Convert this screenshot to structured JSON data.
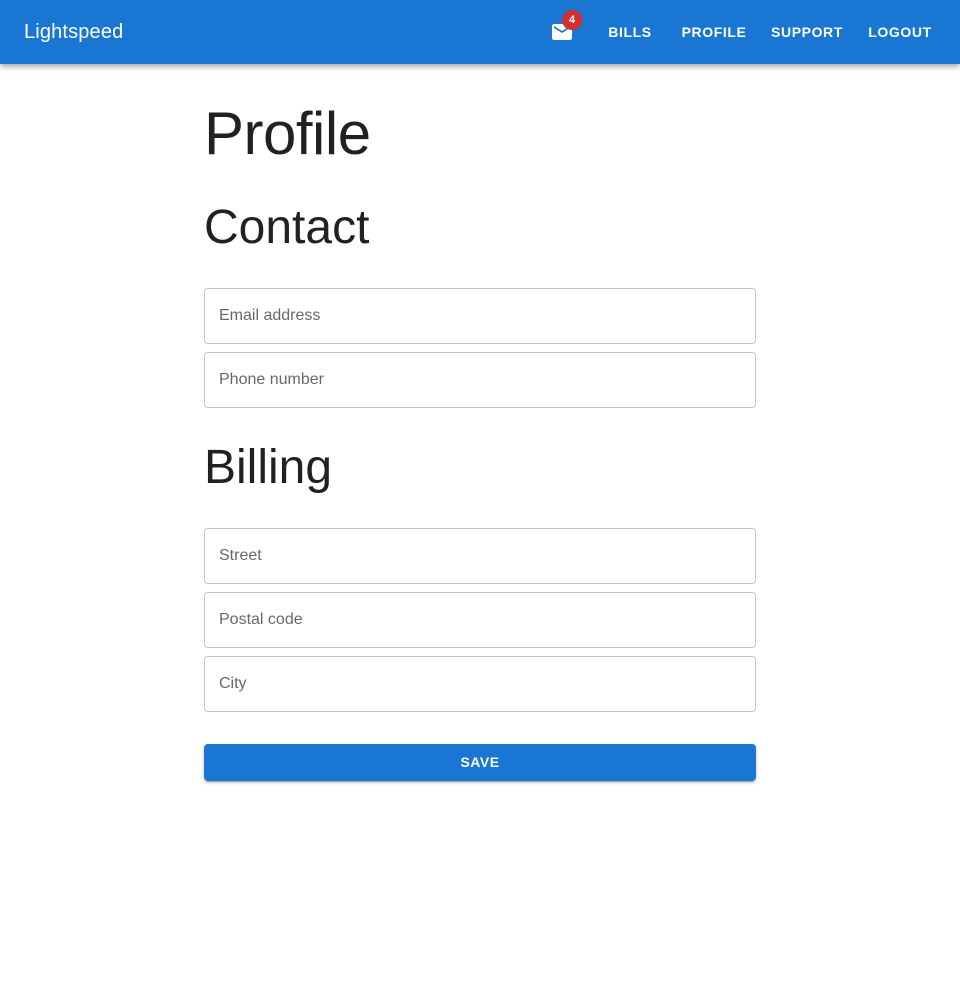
{
  "app_bar": {
    "brand": "Lightspeed",
    "mail_icon": "mail-icon",
    "unread_count": "4",
    "nav": {
      "bills": "BILLS",
      "profile": "PROFILE",
      "support": "SUPPORT",
      "logout": "LOGOUT"
    },
    "background_color": "#1976d2",
    "badge_color": "#d32f2f"
  },
  "main": {
    "page_title": "Profile",
    "contact": {
      "title": "Contact",
      "email": {
        "value": "",
        "placeholder": "Email address"
      },
      "phone": {
        "value": "",
        "placeholder": "Phone number"
      }
    },
    "billing": {
      "title": "Billing",
      "street": {
        "value": "",
        "placeholder": "Street"
      },
      "postal_code": {
        "value": "",
        "placeholder": "Postal code"
      },
      "city": {
        "value": "",
        "placeholder": "City"
      }
    },
    "save_label": "SAVE"
  }
}
